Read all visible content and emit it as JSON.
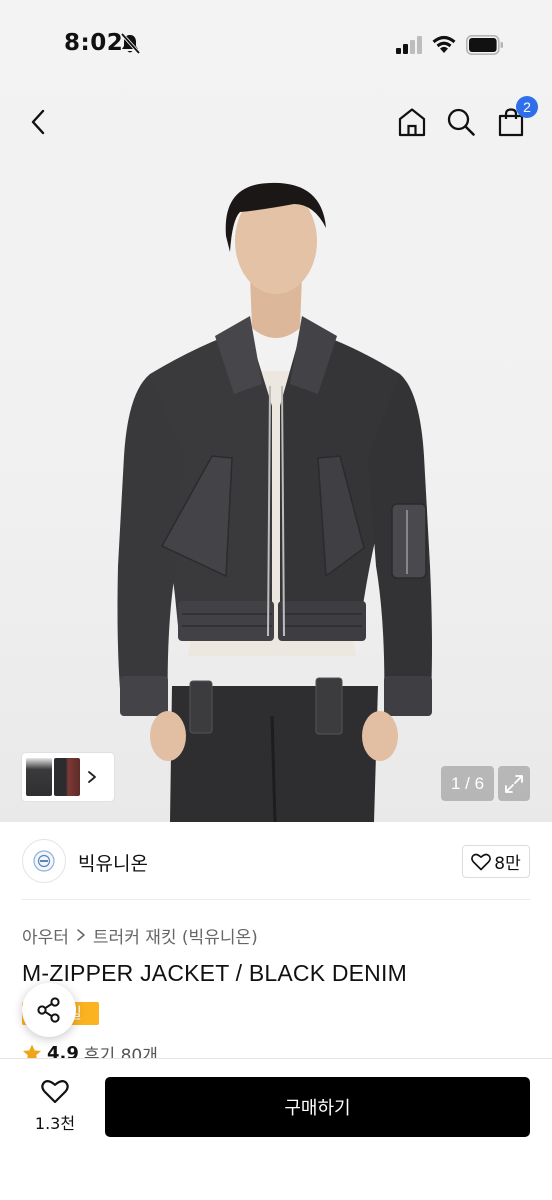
{
  "status": {
    "time": "8:02"
  },
  "cart": {
    "count": "2"
  },
  "gallery": {
    "page_indicator": "1 / 6"
  },
  "brand": {
    "name": "빅유니온",
    "likes": "8만"
  },
  "breadcrumb": {
    "category": "아우터",
    "subcategory": "트러커 재킷 (빅유니온)"
  },
  "product": {
    "title": "M-ZIPPER JACKET / BLACK DENIM",
    "promo_badge": "일",
    "rating": "4.9",
    "reviews": "후기 80개"
  },
  "bottom": {
    "wish_count": "1.3천",
    "buy_label": "구매하기"
  },
  "colors": {
    "accent_blue": "#2f6fea",
    "badge_orange": "#fbb321",
    "buy_button": "#000000"
  }
}
